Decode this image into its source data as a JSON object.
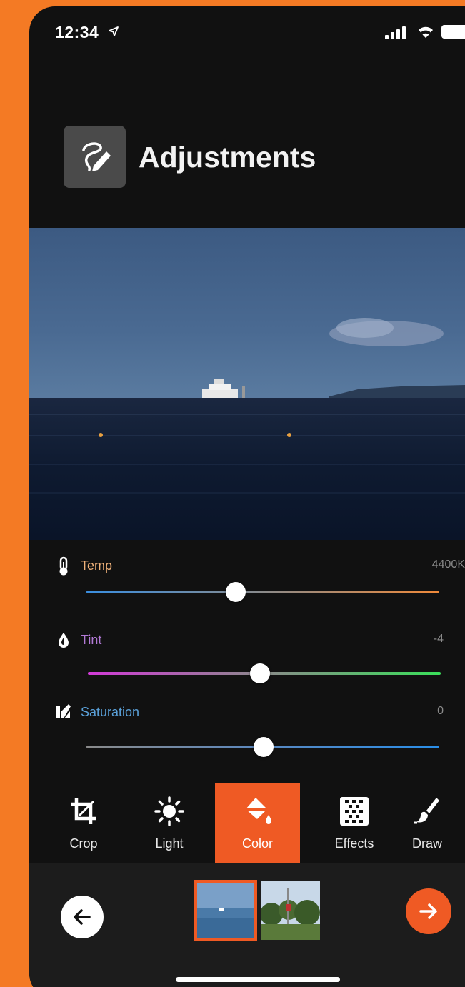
{
  "status_bar": {
    "time": "12:34"
  },
  "header": {
    "title": "Adjustments",
    "icon": "draw-pencil-icon"
  },
  "adjustments": [
    {
      "label": "Temp",
      "value": "4400K",
      "icon": "thermometer-icon",
      "label_color": "#f0b27a",
      "level": 0.42
    },
    {
      "label": "Tint",
      "value": "-4",
      "icon": "droplet-icon",
      "label_color": "#b27ad6",
      "level": 0.49
    },
    {
      "label": "Saturation",
      "value": "0",
      "icon": "saturation-icon",
      "label_color": "#5aa0d8",
      "level": 0.5
    }
  ],
  "toolbar": {
    "tools": [
      {
        "label": "Crop",
        "icon": "crop-icon"
      },
      {
        "label": "Light",
        "icon": "sun-icon"
      },
      {
        "label": "Color",
        "icon": "paint-bucket-icon"
      },
      {
        "label": "Effects",
        "icon": "effects-grid-icon"
      },
      {
        "label": "Draw",
        "icon": "brush-icon"
      }
    ],
    "active": "Color"
  },
  "colors": {
    "accent": "#EF5A24",
    "background": "#111111",
    "frame": "#F47A24"
  }
}
